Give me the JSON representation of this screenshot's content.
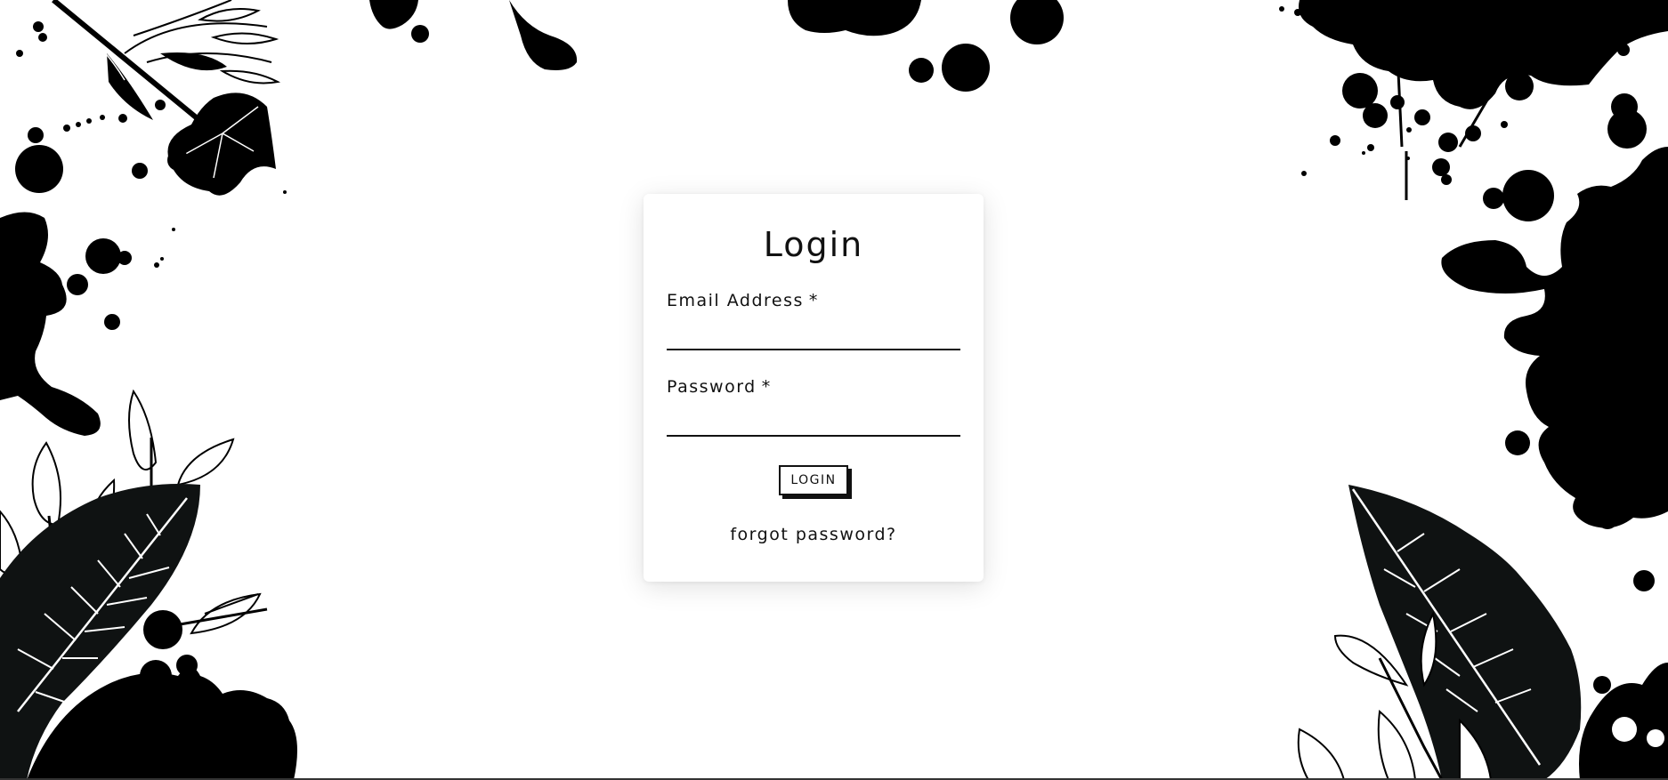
{
  "login": {
    "title": "Login",
    "email_label": "Email Address",
    "email_value": "",
    "password_label": "Password",
    "password_value": "",
    "required_marker": "*",
    "submit_label": "LOGIN",
    "forgot_link": "forgot password?"
  },
  "decoration": {
    "colors": {
      "ink": "#000000",
      "leaf": "#0f1212",
      "vein": "#ffffff"
    }
  }
}
